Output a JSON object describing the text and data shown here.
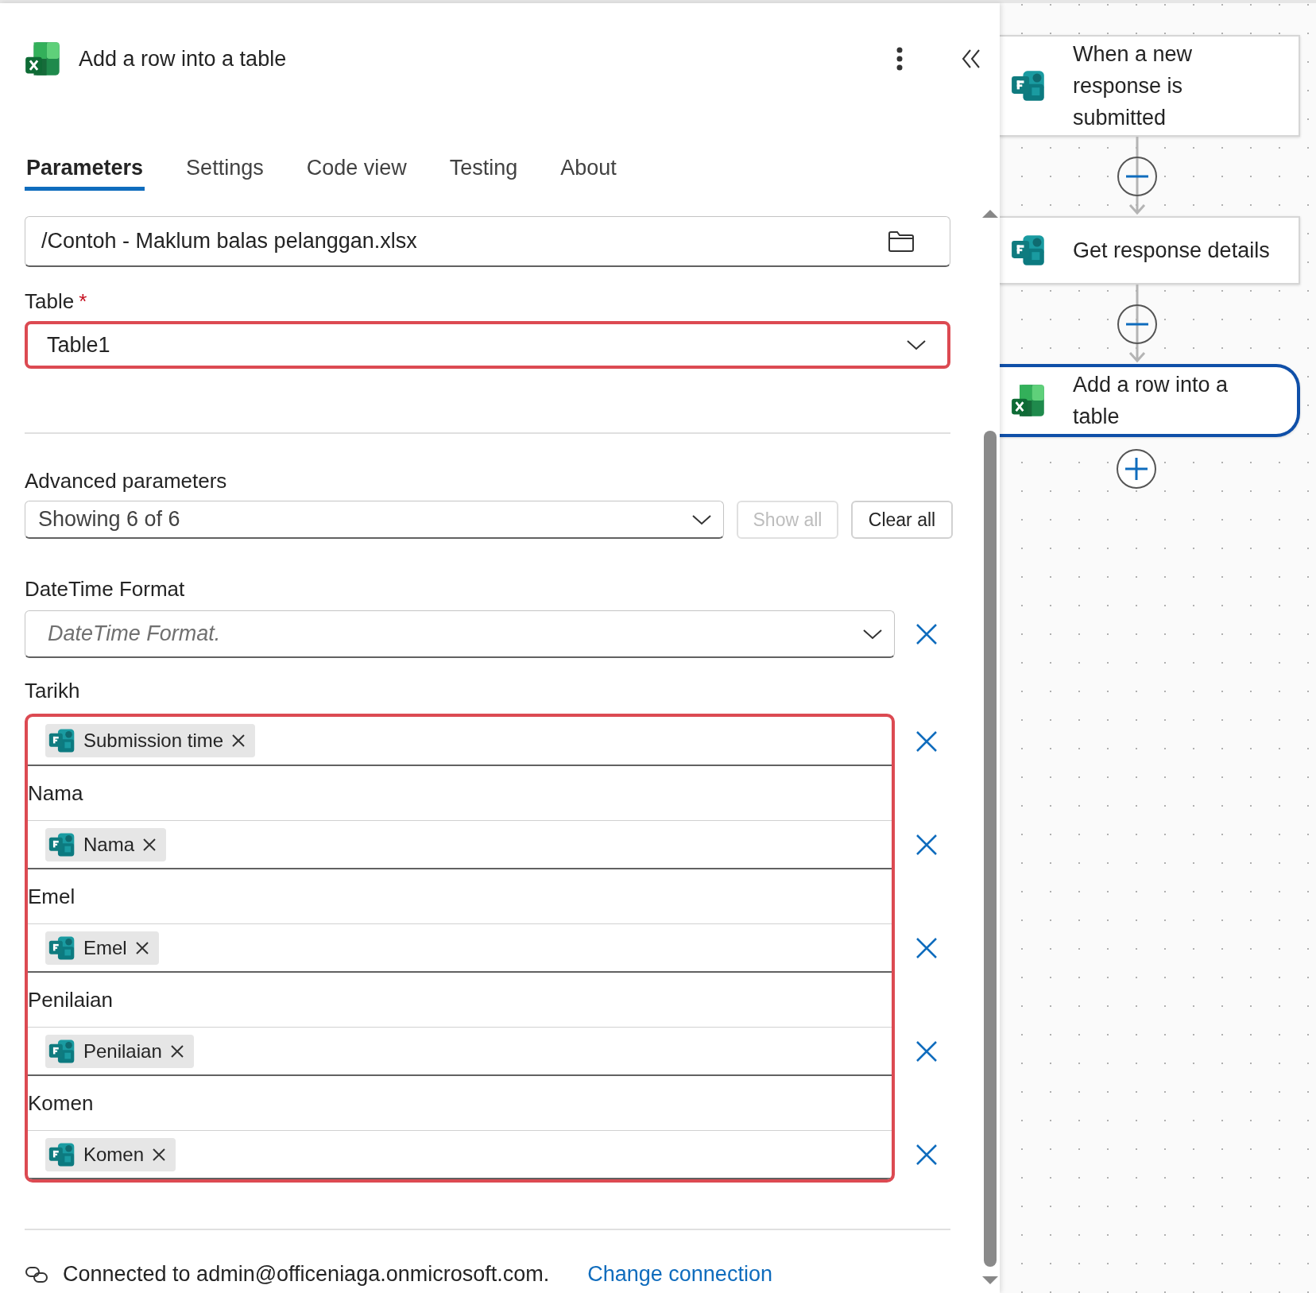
{
  "panel": {
    "title": "Add a row into a table",
    "tabs": [
      {
        "label": "Parameters",
        "selected": true
      },
      {
        "label": "Settings",
        "selected": false
      },
      {
        "label": "Code view",
        "selected": false
      },
      {
        "label": "Testing",
        "selected": false
      },
      {
        "label": "About",
        "selected": false
      }
    ],
    "file": {
      "value": "/Contoh - Maklum balas pelanggan.xlsx"
    },
    "table": {
      "label": "Table",
      "required_mark": "*",
      "value": "Table1",
      "highlighted": true
    },
    "advanced": {
      "label": "Advanced parameters",
      "value": "Showing 6 of 6",
      "buttons": [
        {
          "label": "Show all",
          "disabled": true
        },
        {
          "label": "Clear all",
          "disabled": false
        }
      ]
    },
    "datetime_format": {
      "label": "DateTime Format",
      "placeholder": "DateTime Format."
    },
    "mapped_fields": {
      "highlighted": true,
      "items": [
        {
          "label": "Tarikh",
          "token": "Submission time"
        },
        {
          "label": "Nama",
          "token": "Nama"
        },
        {
          "label": "Emel",
          "token": "Emel"
        },
        {
          "label": "Penilaian",
          "token": "Penilaian"
        },
        {
          "label": "Komen",
          "token": "Komen"
        }
      ]
    },
    "connection": {
      "text": "Connected to admin@officeniaga.onmicrosoft.com.",
      "link": "Change connection"
    }
  },
  "flow": {
    "steps": [
      {
        "title": "When a new response is submitted",
        "kind": "forms",
        "selected": false
      },
      {
        "title": "Get response details",
        "kind": "forms",
        "selected": false
      },
      {
        "title": "Add a row into a table",
        "kind": "excel",
        "selected": true
      }
    ]
  }
}
